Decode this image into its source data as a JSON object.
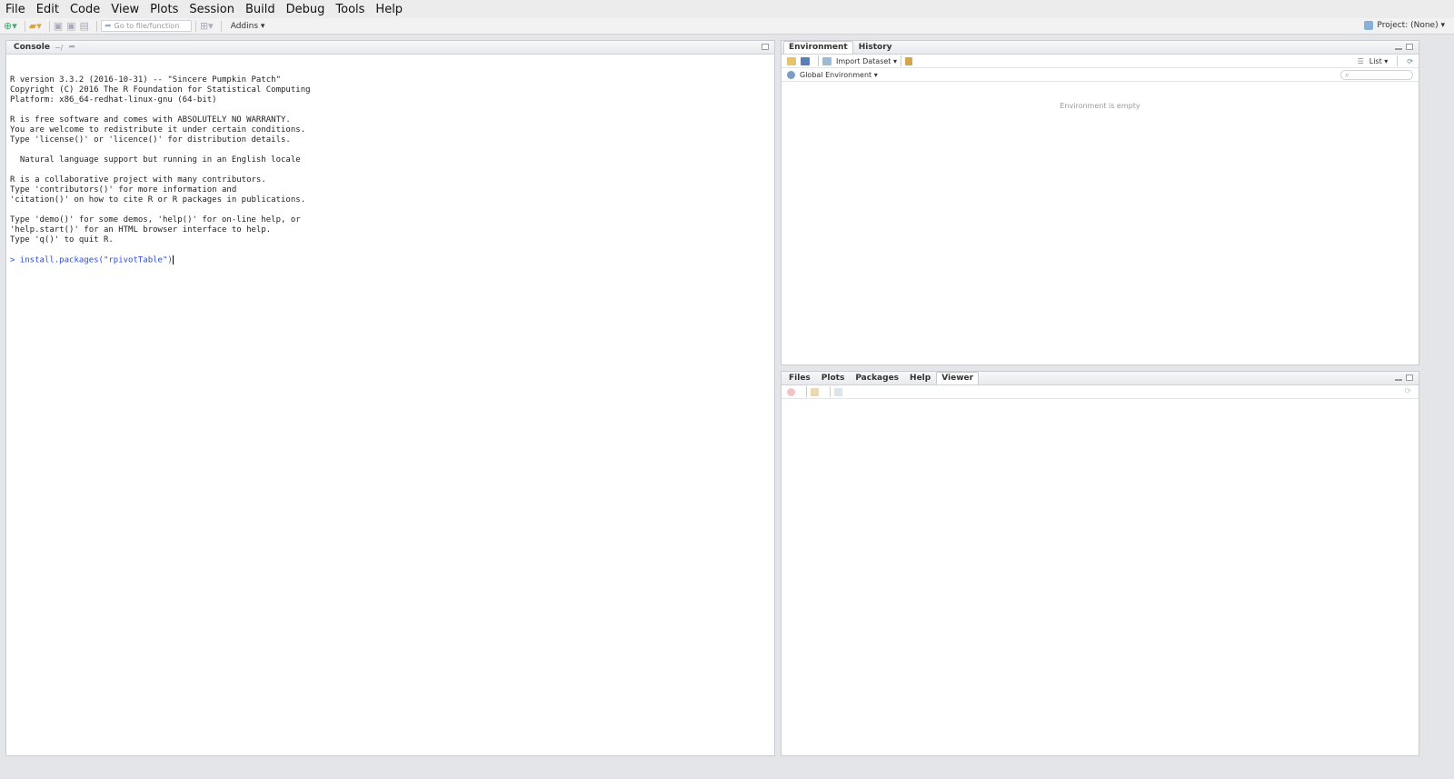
{
  "menu": [
    "File",
    "Edit",
    "Code",
    "View",
    "Plots",
    "Session",
    "Build",
    "Debug",
    "Tools",
    "Help"
  ],
  "toolbar": {
    "goto_placeholder": "Go to file/function",
    "addins": "Addins ▾",
    "project": "Project: (None) ▾"
  },
  "console": {
    "title": "Console",
    "path": "~/",
    "lines": [
      "R version 3.3.2 (2016-10-31) -- \"Sincere Pumpkin Patch\"",
      "Copyright (C) 2016 The R Foundation for Statistical Computing",
      "Platform: x86_64-redhat-linux-gnu (64-bit)",
      "",
      "R is free software and comes with ABSOLUTELY NO WARRANTY.",
      "You are welcome to redistribute it under certain conditions.",
      "Type 'license()' or 'licence()' for distribution details.",
      "",
      "  Natural language support but running in an English locale",
      "",
      "R is a collaborative project with many contributors.",
      "Type 'contributors()' for more information and",
      "'citation()' on how to cite R or R packages in publications.",
      "",
      "Type 'demo()' for some demos, 'help()' for on-line help, or",
      "'help.start()' for an HTML browser interface to help.",
      "Type 'q()' to quit R.",
      ""
    ],
    "prompt": "> install.packages(\"rpivotTable\")"
  },
  "env_pane": {
    "tabs": [
      "Environment",
      "History"
    ],
    "active_tab": "Environment",
    "import_label": "Import Dataset ▾",
    "list_label": "List ▾",
    "scope_label": "Global Environment ▾",
    "empty_text": "Environment is empty"
  },
  "files_pane": {
    "tabs": [
      "Files",
      "Plots",
      "Packages",
      "Help",
      "Viewer"
    ],
    "active_tab": "Viewer"
  }
}
